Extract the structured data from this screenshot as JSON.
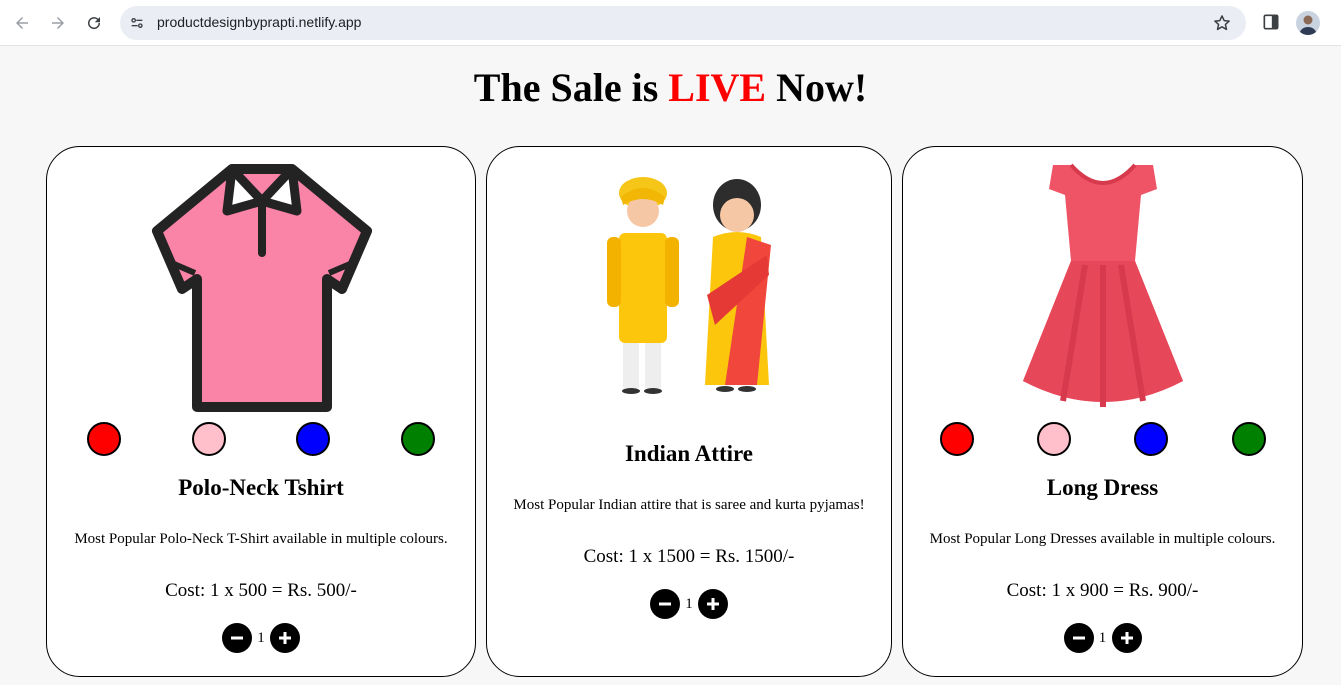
{
  "browser": {
    "url": "productdesignbyprapti.netlify.app"
  },
  "headline": {
    "prefix": "The Sale is ",
    "highlight": "LIVE",
    "suffix": " Now!"
  },
  "products": [
    {
      "title": "Polo-Neck Tshirt",
      "description": "Most Popular Polo-Neck T-Shirt available in multiple colours.",
      "cost": "Cost: 1 x 500 = Rs. 500/-",
      "quantity": "1",
      "colors": [
        "#ff0000",
        "#ffc0cb",
        "#0000ff",
        "#008000"
      ]
    },
    {
      "title": "Indian Attire",
      "description": "Most Popular Indian attire that is saree and kurta pyjamas!",
      "cost": "Cost: 1 x 1500 = Rs. 1500/-",
      "quantity": "1"
    },
    {
      "title": "Long Dress",
      "description": "Most Popular Long Dresses available in multiple colours.",
      "cost": "Cost: 1 x 900 = Rs. 900/-",
      "quantity": "1",
      "colors": [
        "#ff0000",
        "#ffc0cb",
        "#0000ff",
        "#008000"
      ]
    }
  ],
  "colors": {
    "accent": "#ff0000",
    "page_bg": "#f7f7f7"
  }
}
